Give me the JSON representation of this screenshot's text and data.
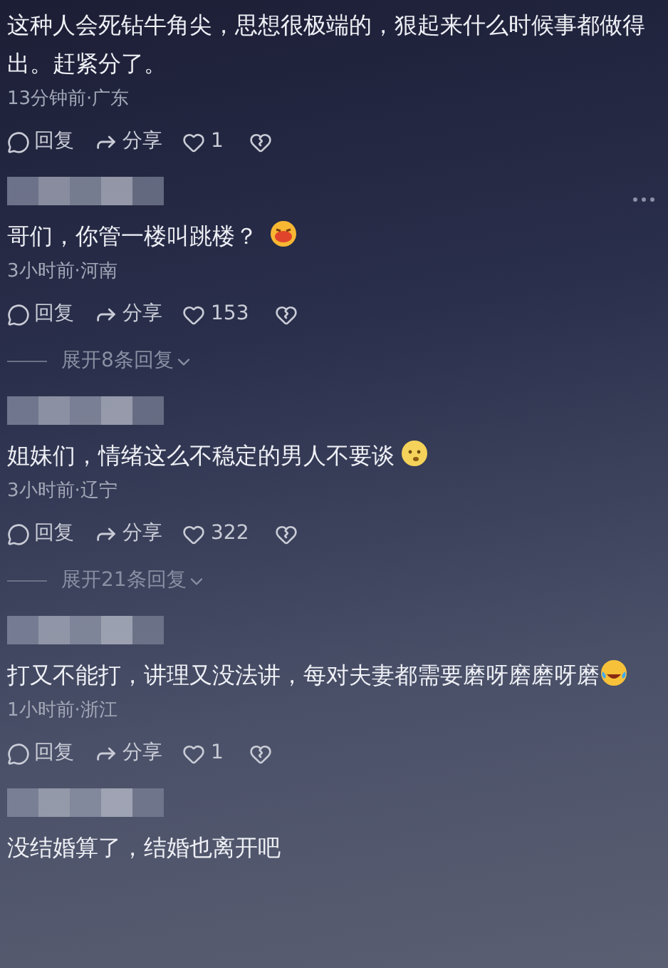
{
  "comments": [
    {
      "has_username": false,
      "more_menu": false,
      "text": "这种人会死钻牛角尖，思想很极端的，狠起来什么时候事都做得出。赶紧分了。",
      "meta": "13分钟前·广东",
      "actions": {
        "reply": "回复",
        "share": "分享",
        "likes": "1"
      }
    },
    {
      "has_username": true,
      "more_menu": true,
      "text": "哥们，你管一楼叫跳楼？",
      "emoji": {
        "kind": "grin"
      },
      "meta": "3小时前·河南",
      "actions": {
        "reply": "回复",
        "share": "分享",
        "likes": "153"
      },
      "expand": "展开8条回复"
    },
    {
      "has_username": true,
      "more_menu": false,
      "text": "姐妹们，情绪这么不稳定的男人不要谈",
      "emoji": {
        "kind": "worried"
      },
      "meta": "3小时前·辽宁",
      "actions": {
        "reply": "回复",
        "share": "分享",
        "likes": "322"
      },
      "expand": "展开21条回复"
    },
    {
      "has_username": true,
      "more_menu": false,
      "text": "打又不能打，讲理又没法讲，每对夫妻都需要磨呀磨磨呀磨",
      "emoji": {
        "kind": "laugh-cry"
      },
      "meta": "1小时前·浙江",
      "actions": {
        "reply": "回复",
        "share": "分享",
        "likes": "1"
      }
    },
    {
      "has_username": true,
      "more_menu": false,
      "text": "没结婚算了，结婚也离开吧"
    }
  ]
}
